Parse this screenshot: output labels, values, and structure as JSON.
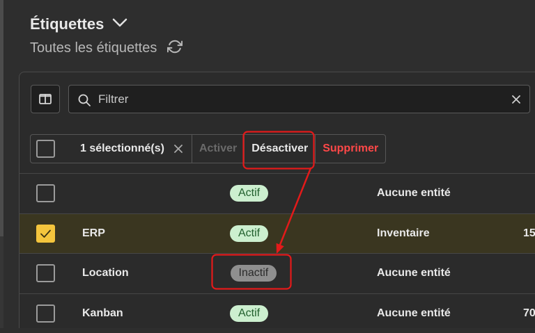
{
  "header": {
    "title": "Étiquettes",
    "title_icon": "chevron-down-icon",
    "subtitle": "Toutes les étiquettes",
    "subtitle_icon": "refresh-icon"
  },
  "toolbar": {
    "columns_button_icon": "columns-icon",
    "filter": {
      "value": "",
      "placeholder": "Filtrer",
      "search_icon": "search-icon",
      "clear_icon": "close-icon"
    }
  },
  "bulk_actions": {
    "selected_label": "1 sélectionné(s)",
    "clear_selection_icon": "close-icon",
    "activate_label": "Activer",
    "activate_disabled": true,
    "deactivate_label": "Désactiver",
    "delete_label": "Supprimer"
  },
  "rows": [
    {
      "selected": false,
      "name": "",
      "status": "Actif",
      "active": true,
      "entity": "Aucune entité",
      "count": ""
    },
    {
      "selected": true,
      "name": "ERP",
      "status": "Actif",
      "active": true,
      "entity": "Inventaire",
      "count": "15"
    },
    {
      "selected": false,
      "name": "Location",
      "status": "Inactif",
      "active": false,
      "entity": "Aucune entité",
      "count": ""
    },
    {
      "selected": false,
      "name": "Kanban",
      "status": "Actif",
      "active": true,
      "entity": "Aucune entité",
      "count": "70"
    }
  ],
  "colors": {
    "background": "#2e2e2e",
    "panel": "#2b2b2b",
    "text": "#e9e9e9",
    "muted_text": "#b7b7b7",
    "disabled_text": "#6a6a6a",
    "danger": "#ff4848",
    "selected_row": "#3a3620",
    "checkbox_checked": "#f4c53d",
    "checkbox_border": "#9b9b9b",
    "badge_active_bg": "#ccefcf",
    "badge_active_text": "#22602e",
    "badge_inactive_bg": "#8f8f8f",
    "badge_inactive_text": "#2a2a2a",
    "annotation": "#e31a1a"
  }
}
